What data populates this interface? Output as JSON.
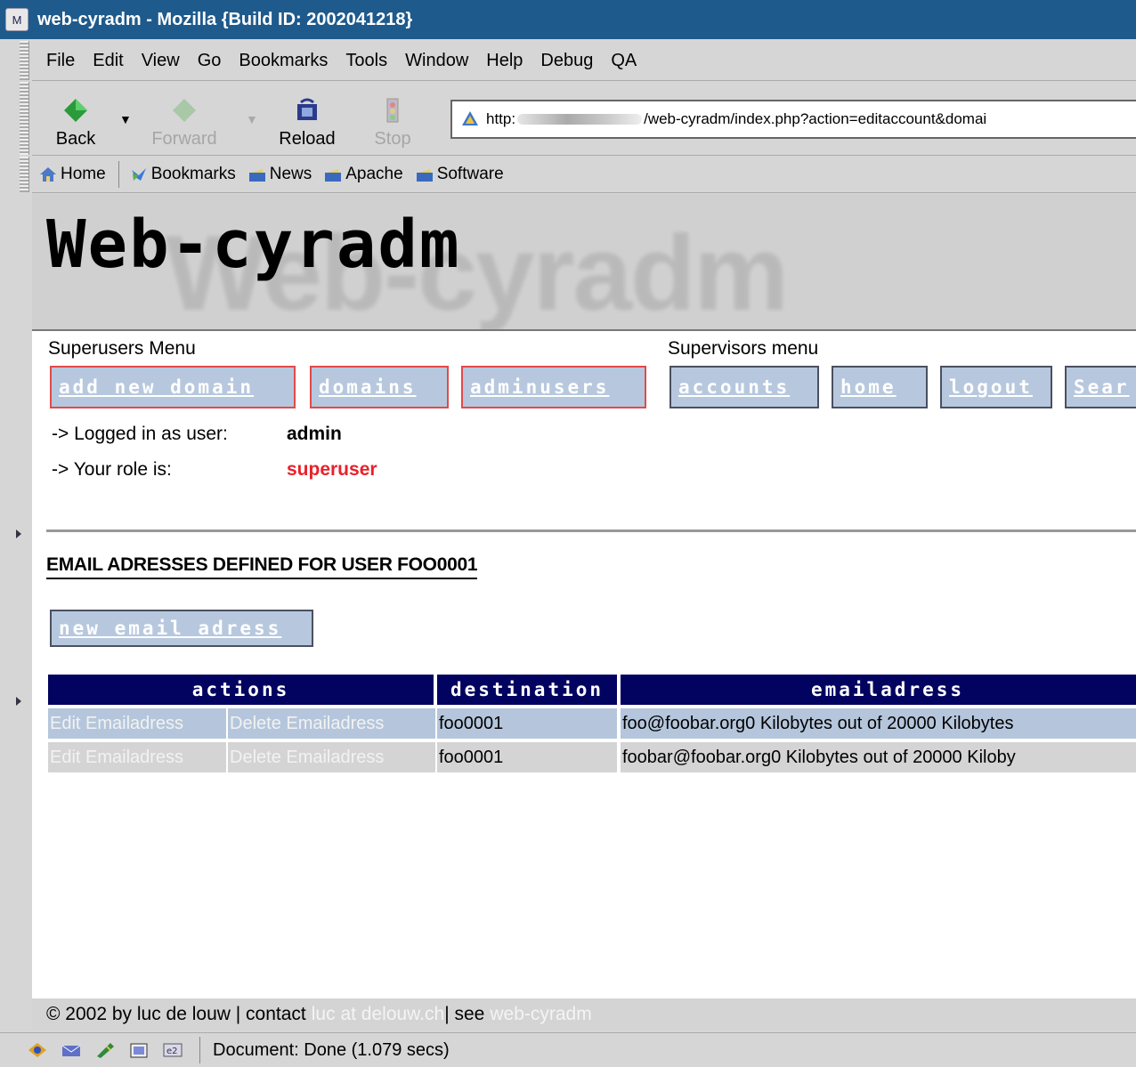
{
  "window": {
    "title": "web-cyradm - Mozilla {Build ID: 2002041218}"
  },
  "menubar": {
    "items": [
      "File",
      "Edit",
      "View",
      "Go",
      "Bookmarks",
      "Tools",
      "Window",
      "Help",
      "Debug",
      "QA"
    ]
  },
  "navbar": {
    "back": "Back",
    "forward": "Forward",
    "reload": "Reload",
    "stop": "Stop",
    "url_prefix": "http:",
    "url_suffix": "/web-cyradm/index.php?action=editaccount&domai"
  },
  "personal_toolbar": {
    "items": [
      "Home",
      "Bookmarks",
      "News",
      "Apache",
      "Software"
    ]
  },
  "banner": {
    "logo": "Web-cyradm",
    "shadow": "Web-cyradm"
  },
  "superusers_menu": {
    "label": "Superusers Menu",
    "buttons": [
      "add new domain",
      "domains",
      "adminusers"
    ]
  },
  "supervisors_menu": {
    "label": "Supervisors menu",
    "buttons": [
      "accounts",
      "home",
      "logout",
      "Sear"
    ]
  },
  "info": {
    "logged_label": "-> Logged in as user:",
    "logged_value": "admin",
    "role_label": "-> Your role is:",
    "role_value": "superuser"
  },
  "heading": "EMAIL ADRESSES DEFINED FOR USER FOO0001",
  "new_email_button": "new email adress",
  "table": {
    "headers": [
      "actions",
      "destination",
      "emailadress"
    ],
    "rows": [
      {
        "edit": "Edit Emailadress",
        "delete": "Delete Emailadress",
        "destination": "foo0001",
        "email": "foo@foobar.org0 Kilobytes out of 20000 Kilobytes"
      },
      {
        "edit": "Edit Emailadress",
        "delete": "Delete Emailadress",
        "destination": "foo0001",
        "email": "foobar@foobar.org0 Kilobytes out of 20000 Kiloby"
      }
    ]
  },
  "footer": {
    "text1": "© 2002 by luc de louw | contact",
    "contact_link": "luc at delouw.ch",
    "text2": "| see",
    "project_link": "web-cyradm"
  },
  "status": {
    "text": "Document: Done (1.079 secs)"
  },
  "colors": {
    "titlebar": "#1e5a8c",
    "table_header": "#020260",
    "button_fill": "#b7c8de",
    "superuser_border": "#e04a4a",
    "role_text": "#e8202a"
  }
}
